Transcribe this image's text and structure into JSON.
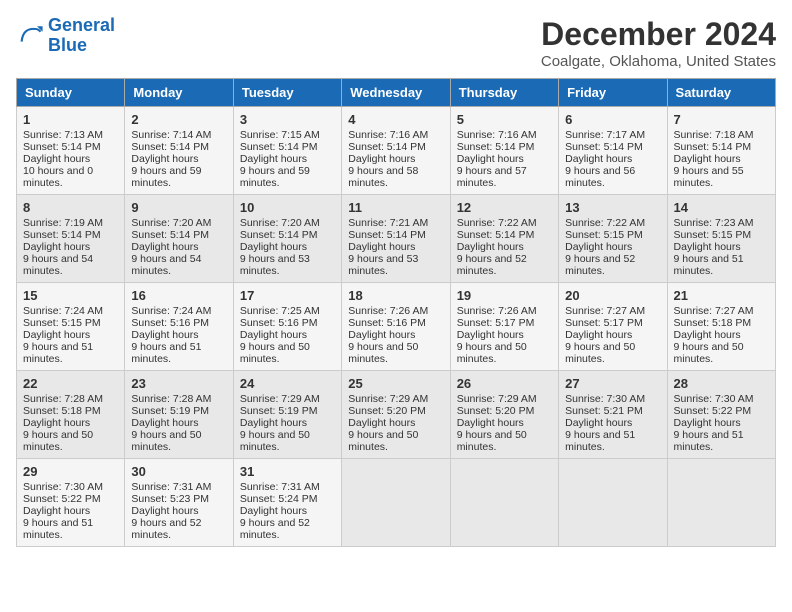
{
  "header": {
    "logo_line1": "General",
    "logo_line2": "Blue",
    "month_title": "December 2024",
    "location": "Coalgate, Oklahoma, United States"
  },
  "days_of_week": [
    "Sunday",
    "Monday",
    "Tuesday",
    "Wednesday",
    "Thursday",
    "Friday",
    "Saturday"
  ],
  "weeks": [
    [
      {
        "day": "1",
        "rise": "7:13 AM",
        "set": "5:14 PM",
        "daylight": "10 hours and 0 minutes."
      },
      {
        "day": "2",
        "rise": "7:14 AM",
        "set": "5:14 PM",
        "daylight": "9 hours and 59 minutes."
      },
      {
        "day": "3",
        "rise": "7:15 AM",
        "set": "5:14 PM",
        "daylight": "9 hours and 59 minutes."
      },
      {
        "day": "4",
        "rise": "7:16 AM",
        "set": "5:14 PM",
        "daylight": "9 hours and 58 minutes."
      },
      {
        "day": "5",
        "rise": "7:16 AM",
        "set": "5:14 PM",
        "daylight": "9 hours and 57 minutes."
      },
      {
        "day": "6",
        "rise": "7:17 AM",
        "set": "5:14 PM",
        "daylight": "9 hours and 56 minutes."
      },
      {
        "day": "7",
        "rise": "7:18 AM",
        "set": "5:14 PM",
        "daylight": "9 hours and 55 minutes."
      }
    ],
    [
      {
        "day": "8",
        "rise": "7:19 AM",
        "set": "5:14 PM",
        "daylight": "9 hours and 54 minutes."
      },
      {
        "day": "9",
        "rise": "7:20 AM",
        "set": "5:14 PM",
        "daylight": "9 hours and 54 minutes."
      },
      {
        "day": "10",
        "rise": "7:20 AM",
        "set": "5:14 PM",
        "daylight": "9 hours and 53 minutes."
      },
      {
        "day": "11",
        "rise": "7:21 AM",
        "set": "5:14 PM",
        "daylight": "9 hours and 53 minutes."
      },
      {
        "day": "12",
        "rise": "7:22 AM",
        "set": "5:14 PM",
        "daylight": "9 hours and 52 minutes."
      },
      {
        "day": "13",
        "rise": "7:22 AM",
        "set": "5:15 PM",
        "daylight": "9 hours and 52 minutes."
      },
      {
        "day": "14",
        "rise": "7:23 AM",
        "set": "5:15 PM",
        "daylight": "9 hours and 51 minutes."
      }
    ],
    [
      {
        "day": "15",
        "rise": "7:24 AM",
        "set": "5:15 PM",
        "daylight": "9 hours and 51 minutes."
      },
      {
        "day": "16",
        "rise": "7:24 AM",
        "set": "5:16 PM",
        "daylight": "9 hours and 51 minutes."
      },
      {
        "day": "17",
        "rise": "7:25 AM",
        "set": "5:16 PM",
        "daylight": "9 hours and 50 minutes."
      },
      {
        "day": "18",
        "rise": "7:26 AM",
        "set": "5:16 PM",
        "daylight": "9 hours and 50 minutes."
      },
      {
        "day": "19",
        "rise": "7:26 AM",
        "set": "5:17 PM",
        "daylight": "9 hours and 50 minutes."
      },
      {
        "day": "20",
        "rise": "7:27 AM",
        "set": "5:17 PM",
        "daylight": "9 hours and 50 minutes."
      },
      {
        "day": "21",
        "rise": "7:27 AM",
        "set": "5:18 PM",
        "daylight": "9 hours and 50 minutes."
      }
    ],
    [
      {
        "day": "22",
        "rise": "7:28 AM",
        "set": "5:18 PM",
        "daylight": "9 hours and 50 minutes."
      },
      {
        "day": "23",
        "rise": "7:28 AM",
        "set": "5:19 PM",
        "daylight": "9 hours and 50 minutes."
      },
      {
        "day": "24",
        "rise": "7:29 AM",
        "set": "5:19 PM",
        "daylight": "9 hours and 50 minutes."
      },
      {
        "day": "25",
        "rise": "7:29 AM",
        "set": "5:20 PM",
        "daylight": "9 hours and 50 minutes."
      },
      {
        "day": "26",
        "rise": "7:29 AM",
        "set": "5:20 PM",
        "daylight": "9 hours and 50 minutes."
      },
      {
        "day": "27",
        "rise": "7:30 AM",
        "set": "5:21 PM",
        "daylight": "9 hours and 51 minutes."
      },
      {
        "day": "28",
        "rise": "7:30 AM",
        "set": "5:22 PM",
        "daylight": "9 hours and 51 minutes."
      }
    ],
    [
      {
        "day": "29",
        "rise": "7:30 AM",
        "set": "5:22 PM",
        "daylight": "9 hours and 51 minutes."
      },
      {
        "day": "30",
        "rise": "7:31 AM",
        "set": "5:23 PM",
        "daylight": "9 hours and 52 minutes."
      },
      {
        "day": "31",
        "rise": "7:31 AM",
        "set": "5:24 PM",
        "daylight": "9 hours and 52 minutes."
      },
      null,
      null,
      null,
      null
    ]
  ]
}
